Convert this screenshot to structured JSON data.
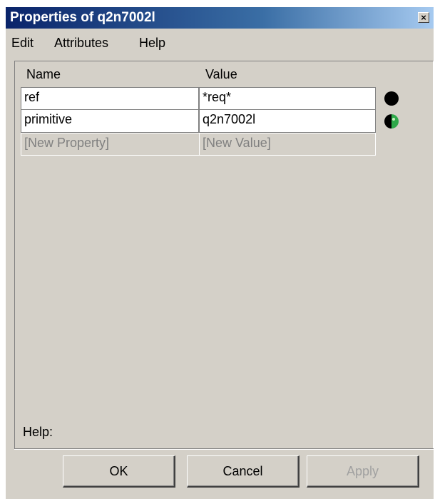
{
  "window": {
    "title": "Properties of q2n7002l",
    "close_glyph": "×"
  },
  "menu": {
    "items": [
      "Edit",
      "Attributes",
      "Help"
    ]
  },
  "table": {
    "headers": {
      "name": "Name",
      "value": "Value"
    },
    "rows": [
      {
        "name": "ref",
        "value": "*req*",
        "status_icon": "filled-black-circle"
      },
      {
        "name": "primitive",
        "value": "q2n7002l",
        "status_icon": "half-black-half-green-circle"
      }
    ],
    "new_row": {
      "name": "[New Property]",
      "value": "[New Value]"
    }
  },
  "help": {
    "label": "Help:"
  },
  "buttons": {
    "ok": "OK",
    "cancel": "Cancel",
    "apply": "Apply"
  },
  "colors": {
    "title_bar": "#0a246a",
    "dialog_bg": "#d4d0c8",
    "status_green": "#2ea84a"
  }
}
